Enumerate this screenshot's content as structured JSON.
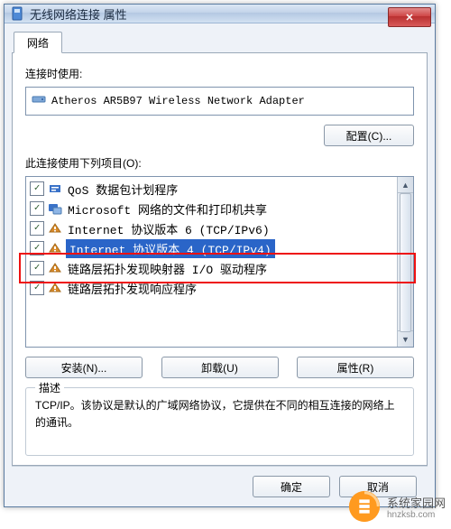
{
  "window": {
    "title": "无线网络连接 属性",
    "close_glyph": "✕"
  },
  "tab": {
    "label": "网络"
  },
  "connect_using": {
    "label": "连接时使用:",
    "adapter": "Atheros AR5B97 Wireless Network Adapter"
  },
  "configure_btn": "配置(C)...",
  "items_label": "此连接使用下列项目(O):",
  "items": [
    {
      "checked": true,
      "icon": "qos",
      "label": "QoS 数据包计划程序"
    },
    {
      "checked": true,
      "icon": "share",
      "label": "Microsoft 网络的文件和打印机共享"
    },
    {
      "checked": true,
      "icon": "proto",
      "label": "Internet 协议版本 6 (TCP/IPv6)"
    },
    {
      "checked": true,
      "icon": "proto",
      "label": "Internet 协议版本 4 (TCP/IPv4)",
      "selected": true
    },
    {
      "checked": true,
      "icon": "proto",
      "label": "链路层拓扑发现映射器 I/O 驱动程序"
    },
    {
      "checked": true,
      "icon": "proto",
      "label": "链路层拓扑发现响应程序"
    }
  ],
  "buttons": {
    "install": "安装(N)...",
    "uninstall": "卸载(U)",
    "properties": "属性(R)"
  },
  "description": {
    "legend": "描述",
    "text": "TCP/IP。该协议是默认的广域网络协议，它提供在不同的相互连接的网络上的通讯。"
  },
  "dialog": {
    "ok": "确定",
    "cancel": "取消"
  },
  "watermark": {
    "brand": "系统家园网",
    "url": "hnzksb.com"
  },
  "icons": {
    "qos_color": "#3a72c8",
    "share_color": "#3a72c8",
    "proto_color": "#d98a2a"
  }
}
